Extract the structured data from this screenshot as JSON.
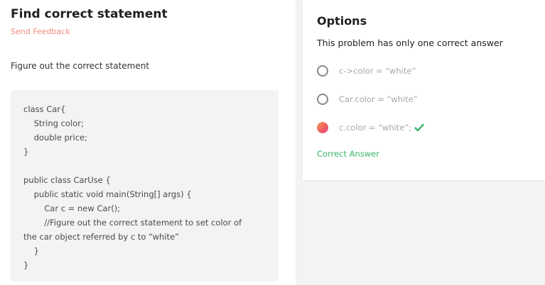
{
  "problem": {
    "title": "Find correct statement",
    "send_feedback": "Send Feedback",
    "description": "Figure out the correct statement",
    "code_lines": [
      "class Car{",
      "    String color;",
      "    double price;",
      "}",
      "",
      "public class CarUse {",
      "    public static void main(String[] args) {",
      "        Car c = new Car();",
      "        //Figure out the correct statement to set color of",
      "the car object referred by c to “white”",
      "    }",
      "}"
    ]
  },
  "options": {
    "title": "Options",
    "subtitle": "This problem has only one correct answer",
    "items": [
      {
        "label": "c->color = “white”",
        "selected": false
      },
      {
        "label": "Car.color = “white”",
        "selected": false
      },
      {
        "label": "c.color = “white”;",
        "selected": true,
        "icon": "check-icon"
      }
    ],
    "result": "Correct Answer",
    "colors": {
      "correct": "#3cb56b",
      "feedback": "#f08a7a",
      "selected_gradient": [
        "#f5a05a",
        "#f06060",
        "#e24d8a"
      ]
    }
  }
}
